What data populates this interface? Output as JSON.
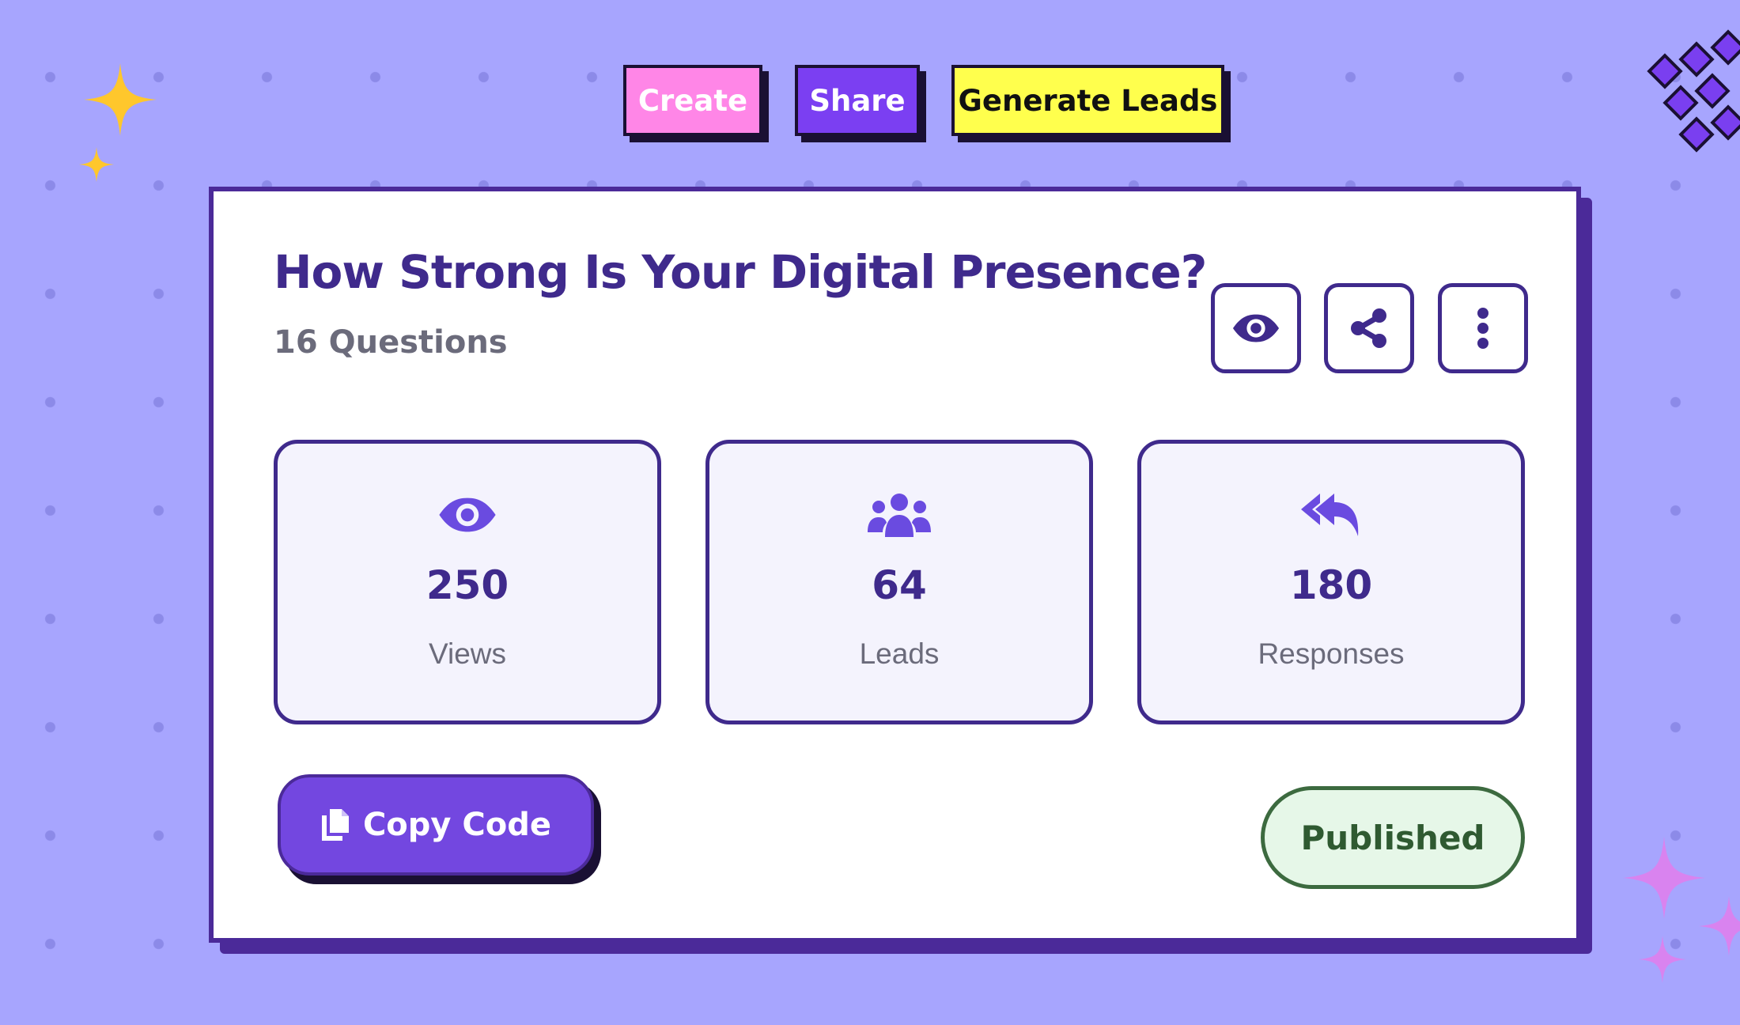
{
  "tabs": {
    "create": "Create",
    "share": "Share",
    "generate_leads": "Generate Leads"
  },
  "card": {
    "title": "How Strong Is Your Digital Presence?",
    "subtitle": "16 Questions",
    "actions": {
      "preview_icon": "eye-icon",
      "share_icon": "share-icon",
      "more_icon": "more-vertical-icon"
    },
    "stats": [
      {
        "icon": "eye-icon",
        "value": "250",
        "label": "Views"
      },
      {
        "icon": "users-icon",
        "value": "64",
        "label": "Leads"
      },
      {
        "icon": "reply-all-icon",
        "value": "180",
        "label": "Responses"
      }
    ],
    "copy_button": {
      "icon": "copy-icon",
      "label": "Copy Code"
    },
    "status": "Published"
  },
  "colors": {
    "background": "#a7a5fe",
    "primary": "#3f2a8c",
    "accent": "#7347e0",
    "create_tag": "#ff86e7",
    "share_tag": "#7b3ff2",
    "leads_tag": "#ffff4d",
    "status_bg": "#e6f7e8",
    "status_text": "#2f5a31"
  }
}
